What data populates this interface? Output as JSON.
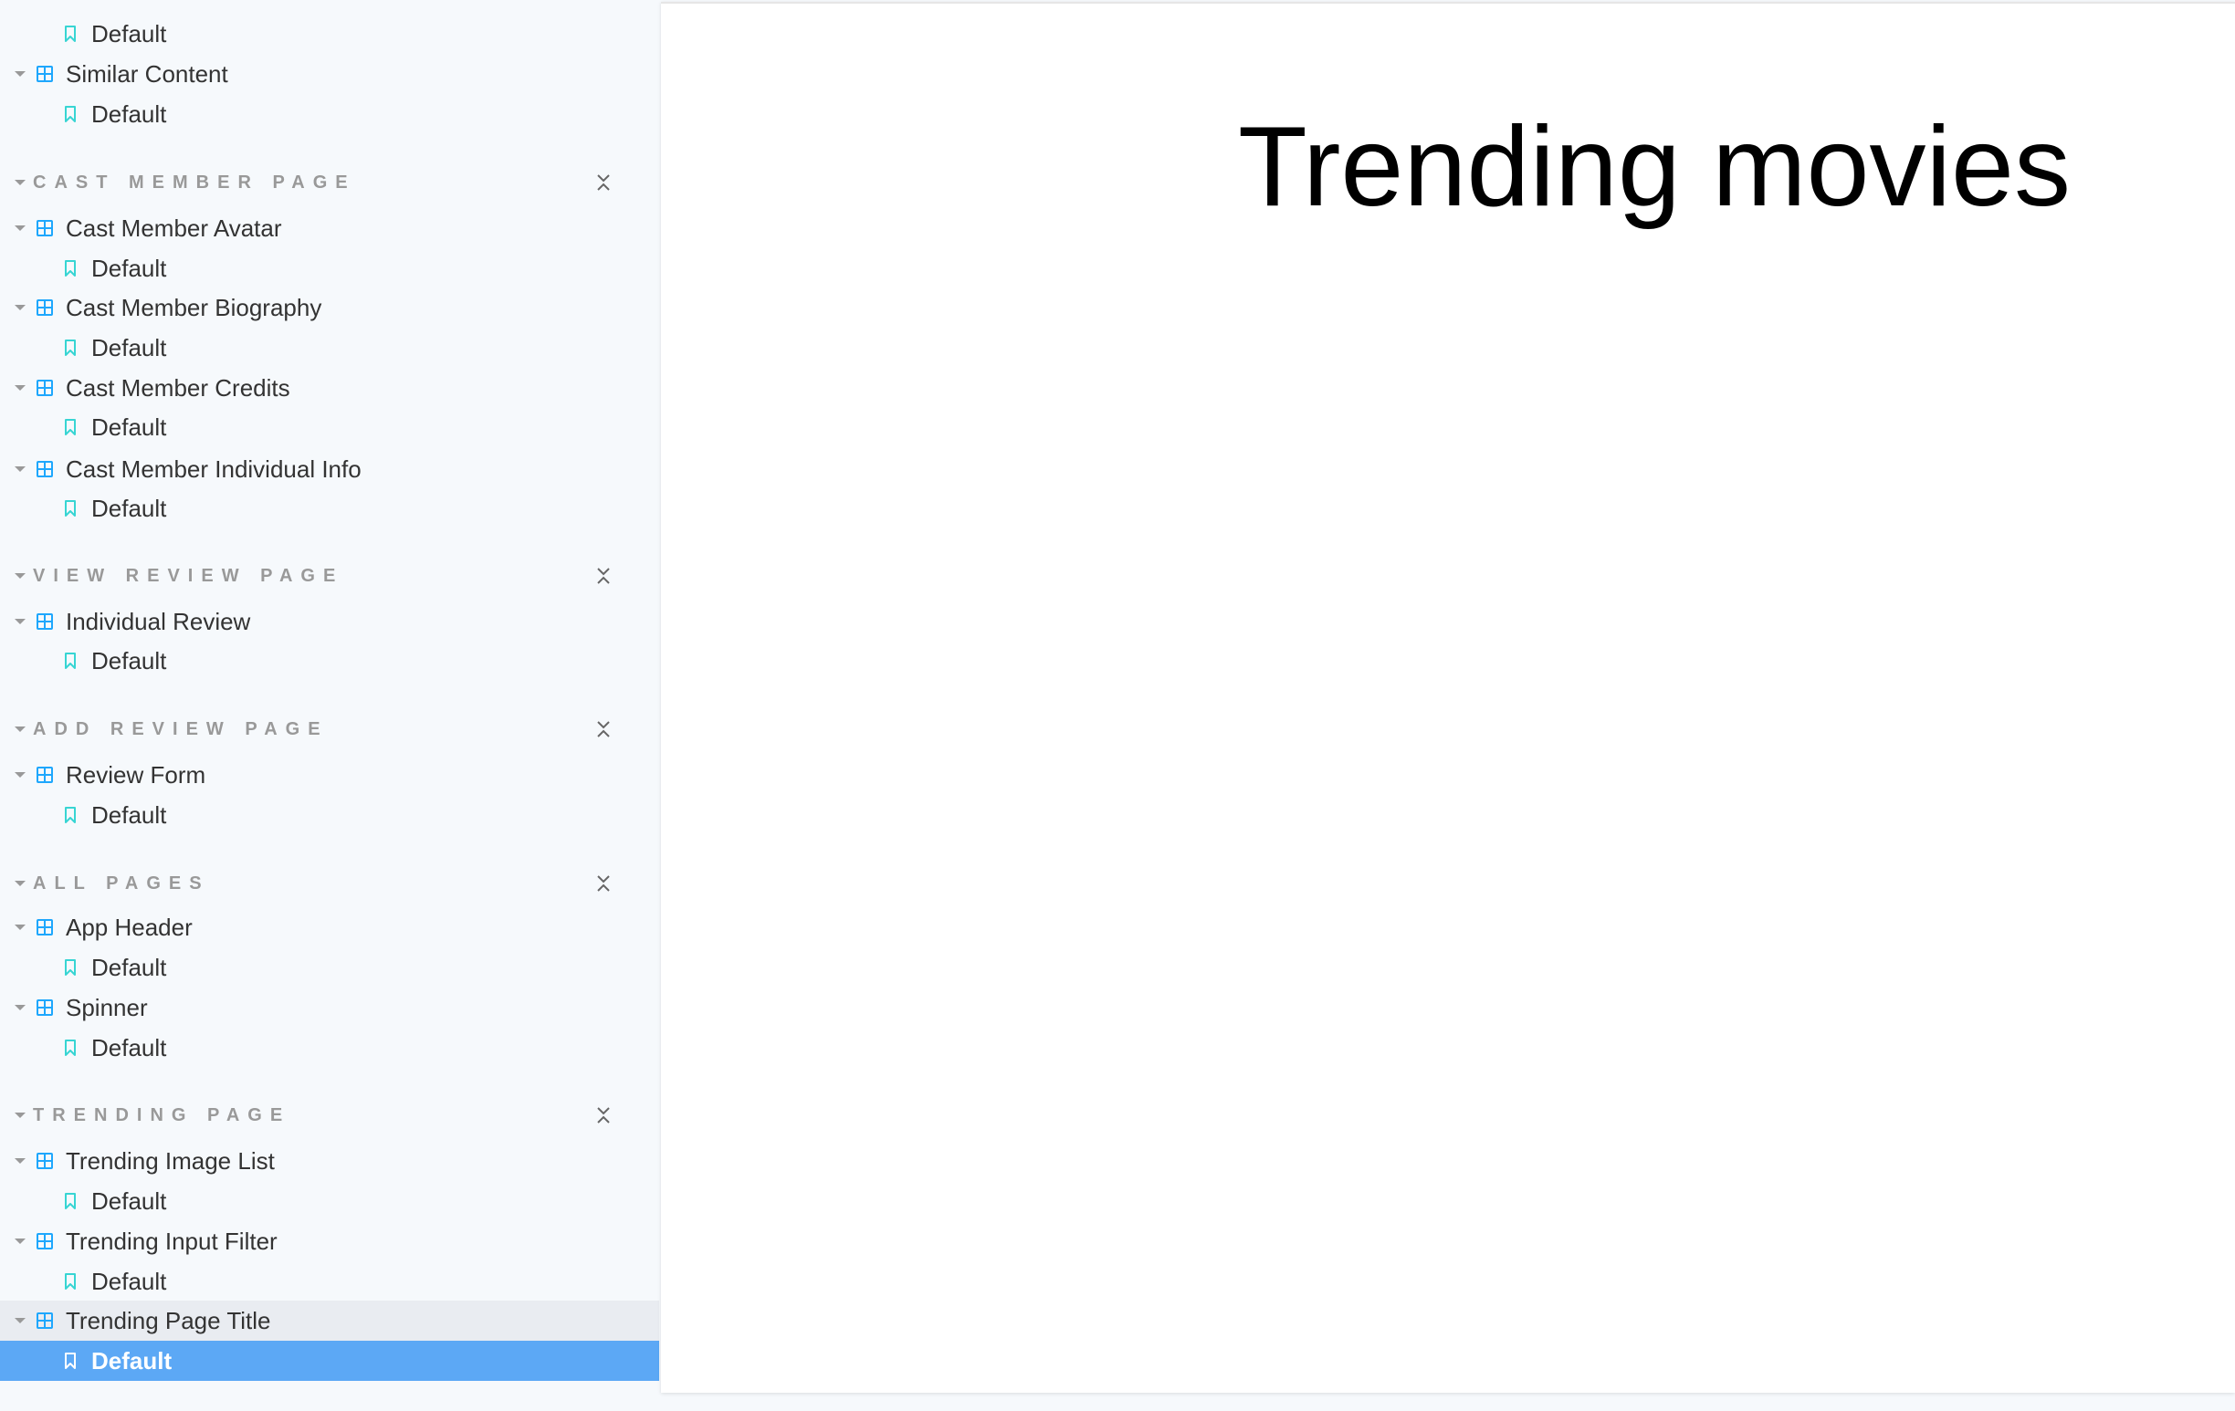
{
  "sidebar": {
    "rows": [
      {
        "kind": "story",
        "label": "Default"
      },
      {
        "kind": "component",
        "label": "Similar Content"
      },
      {
        "kind": "story",
        "label": "Default"
      },
      {
        "kind": "group",
        "label": "CAST MEMBER PAGE"
      },
      {
        "kind": "component",
        "label": "Cast Member Avatar"
      },
      {
        "kind": "story",
        "label": "Default"
      },
      {
        "kind": "component",
        "label": "Cast Member Biography"
      },
      {
        "kind": "story",
        "label": "Default"
      },
      {
        "kind": "component",
        "label": "Cast Member Credits"
      },
      {
        "kind": "story",
        "label": "Default"
      },
      {
        "kind": "component",
        "label": "Cast Member Individual Info"
      },
      {
        "kind": "story",
        "label": "Default"
      },
      {
        "kind": "group",
        "label": "VIEW REVIEW PAGE"
      },
      {
        "kind": "component",
        "label": "Individual Review"
      },
      {
        "kind": "story",
        "label": "Default"
      },
      {
        "kind": "group",
        "label": "ADD REVIEW PAGE"
      },
      {
        "kind": "component",
        "label": "Review Form"
      },
      {
        "kind": "story",
        "label": "Default"
      },
      {
        "kind": "group",
        "label": "ALL PAGES"
      },
      {
        "kind": "component",
        "label": "App Header"
      },
      {
        "kind": "story",
        "label": "Default"
      },
      {
        "kind": "component",
        "label": "Spinner"
      },
      {
        "kind": "story",
        "label": "Default"
      },
      {
        "kind": "group",
        "label": "TRENDING PAGE"
      },
      {
        "kind": "component",
        "label": "Trending Image List"
      },
      {
        "kind": "story",
        "label": "Default"
      },
      {
        "kind": "component",
        "label": "Trending Input Filter"
      },
      {
        "kind": "story",
        "label": "Default"
      },
      {
        "kind": "component",
        "label": "Trending Page Title",
        "state": "hover"
      },
      {
        "kind": "story",
        "label": "Default",
        "state": "selected"
      }
    ]
  },
  "preview": {
    "title": "Trending movies"
  },
  "colors": {
    "accent": "#1ea7fd",
    "story_icon": "#37d5d3",
    "selected_bg": "#5ca8f5",
    "group_label": "#999999"
  }
}
